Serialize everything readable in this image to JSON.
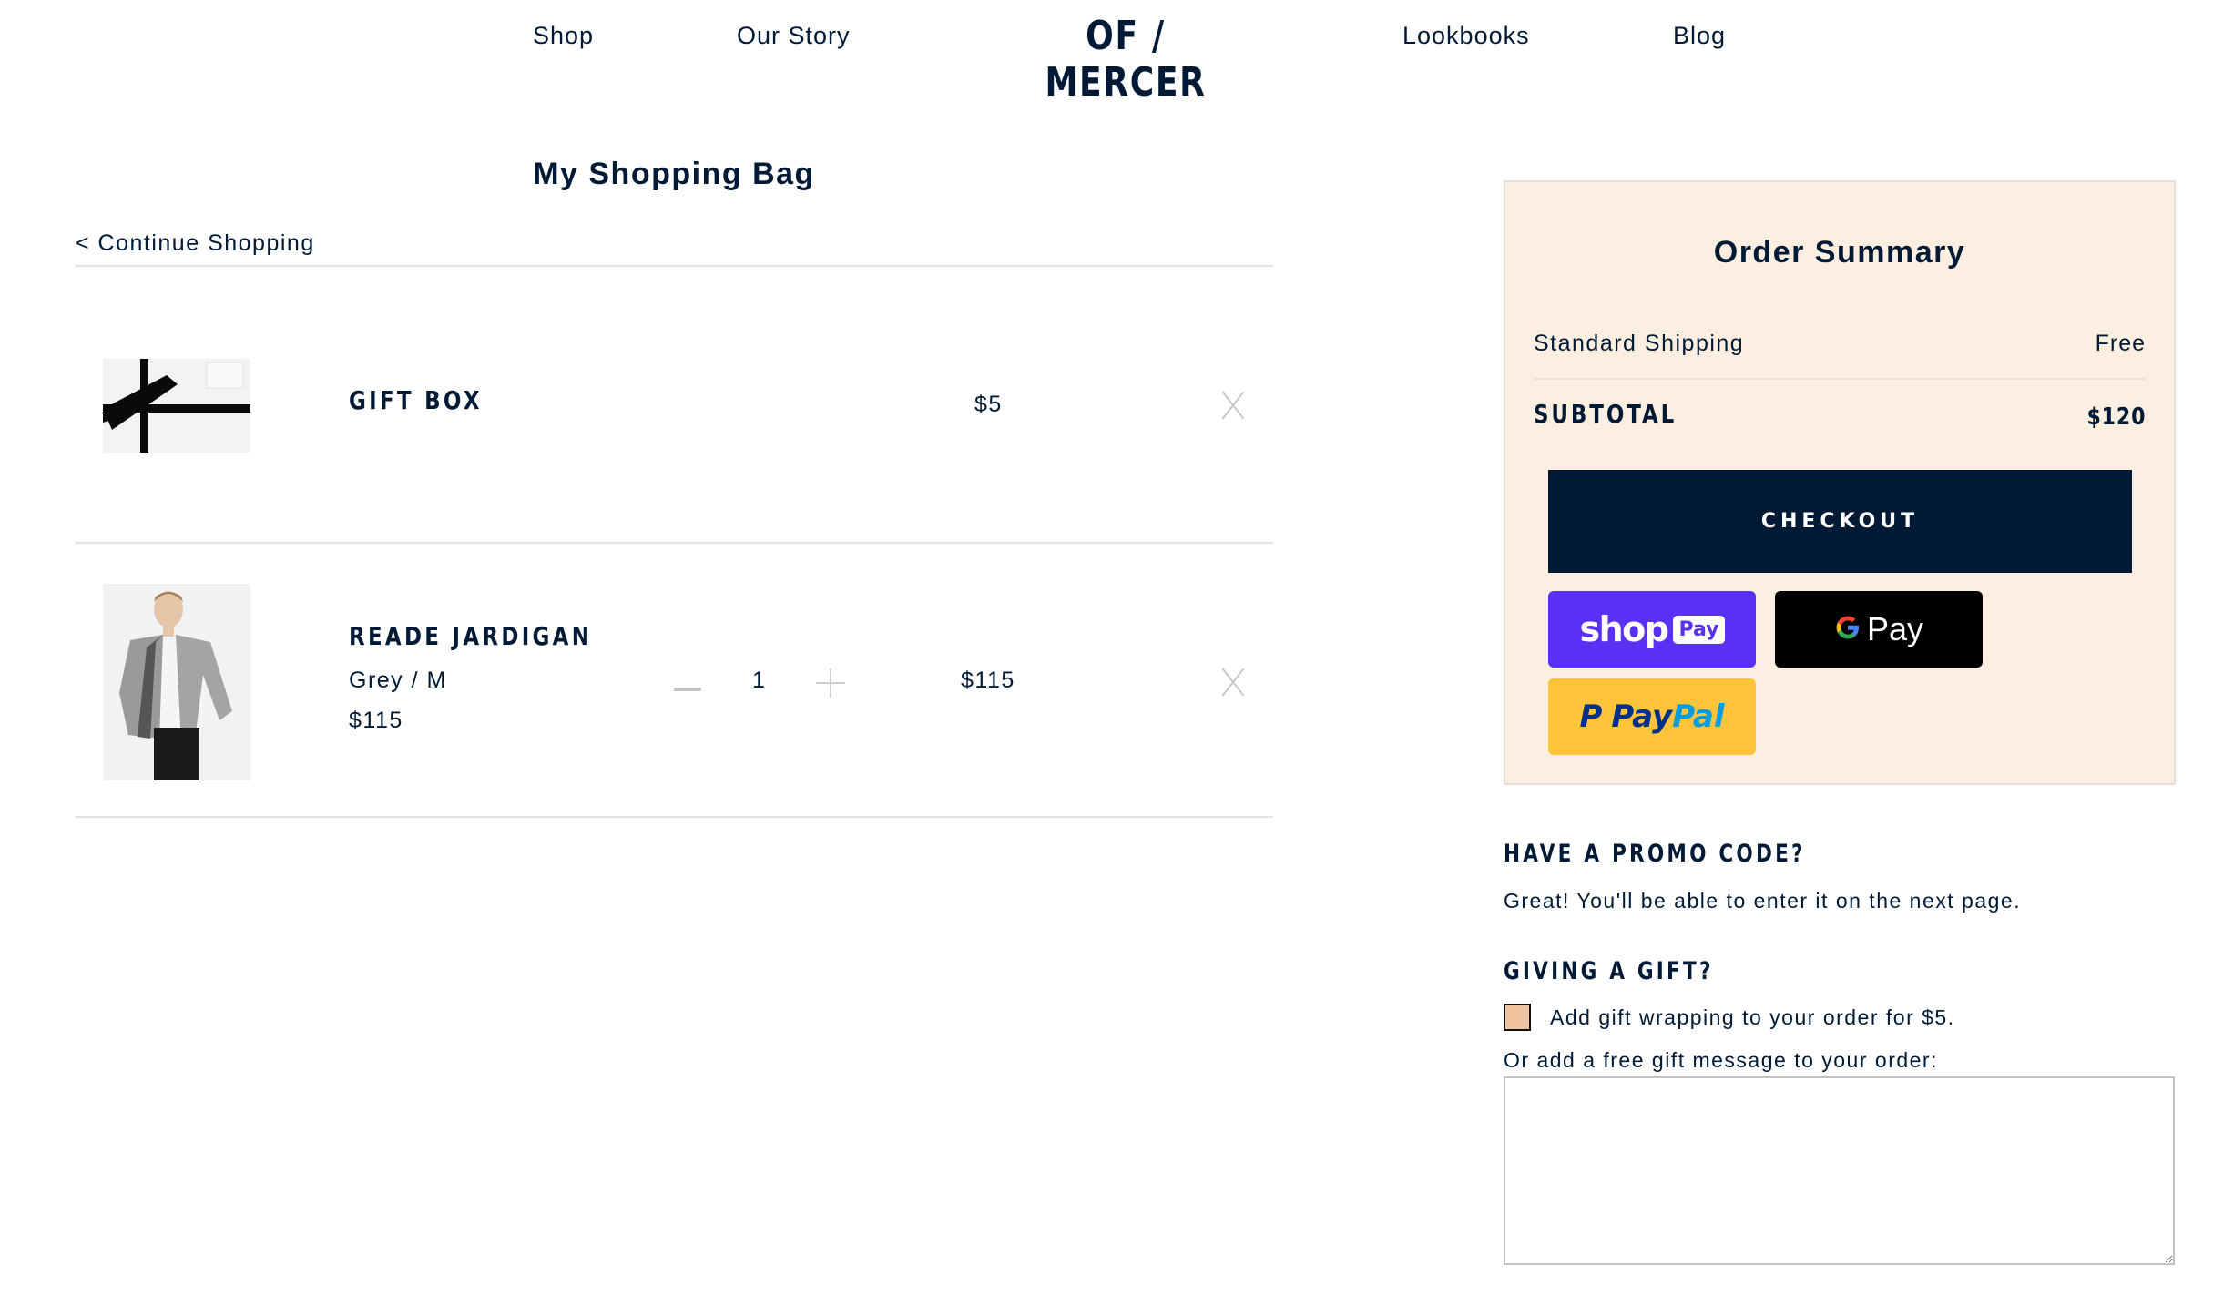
{
  "nav": {
    "left_links": [
      "Shop",
      "Our Story"
    ],
    "logo": "OF / MERCER",
    "right_links": [
      "Lookbooks",
      "Blog"
    ]
  },
  "bag": {
    "title": "My Shopping Bag",
    "continue_label": "< Continue Shopping",
    "items": [
      {
        "name": "GIFT BOX",
        "image": "gift-box-photo",
        "line_price": "$5"
      },
      {
        "name": "READE JARDIGAN",
        "image": "reade-jardigan-photo",
        "variant": "Grey / M",
        "unit_price": "$115",
        "quantity": "1",
        "line_price": "$115"
      }
    ]
  },
  "summary": {
    "title": "Order Summary",
    "shipping_label": "Standard Shipping",
    "shipping_value": "Free",
    "subtotal_label": "SUBTOTAL",
    "subtotal_value": "$120",
    "checkout_label": "CHECKOUT",
    "payments": {
      "shop_pay": {
        "word": "shop",
        "badge": "Pay"
      },
      "google_pay": {
        "g": "G",
        "text": "Pay"
      },
      "paypal": {
        "mark": "P",
        "pay": "Pay",
        "pal": "Pal"
      }
    }
  },
  "promo": {
    "heading": "HAVE A PROMO CODE?",
    "text": "Great! You'll be able to enter it on the next page."
  },
  "gift": {
    "heading": "GIVING A GIFT?",
    "wrap_label": "Add gift wrapping to your order for $5.",
    "wrap_checked": false,
    "message_label": "Or add a free gift message to your order:",
    "message_value": ""
  },
  "colors": {
    "navy": "#001a35",
    "summary_bg": "#fcefe2",
    "shop_pay": "#5a31f4",
    "paypal": "#ffc439",
    "checkbox_fill": "#f0c3a0"
  }
}
